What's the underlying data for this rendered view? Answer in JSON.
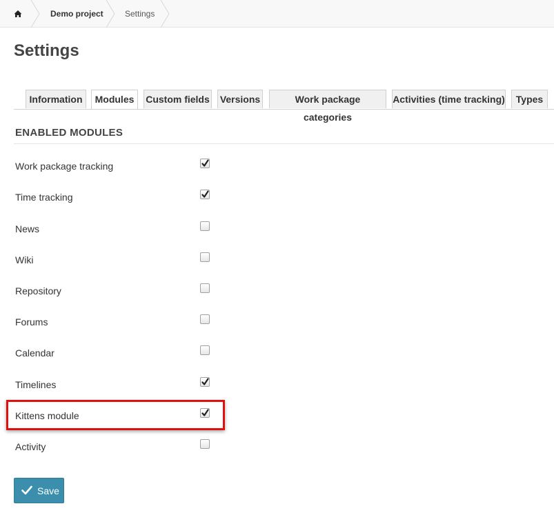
{
  "breadcrumb": {
    "home_icon": "home-icon",
    "items": [
      "Demo project",
      "Settings"
    ]
  },
  "page": {
    "title": "Settings"
  },
  "tabs": [
    {
      "label": "Information",
      "active": false
    },
    {
      "label": "Modules",
      "active": true
    },
    {
      "label": "Custom fields",
      "active": false
    },
    {
      "label": "Versions",
      "active": false
    },
    {
      "label": "Work package categories",
      "active": false
    },
    {
      "label": "Activities (time tracking)",
      "active": false
    },
    {
      "label": "Types",
      "active": false
    }
  ],
  "section": {
    "title": "ENABLED MODULES"
  },
  "modules": [
    {
      "label": "Work package tracking",
      "checked": true
    },
    {
      "label": "Time tracking",
      "checked": true
    },
    {
      "label": "News",
      "checked": false
    },
    {
      "label": "Wiki",
      "checked": false
    },
    {
      "label": "Repository",
      "checked": false
    },
    {
      "label": "Forums",
      "checked": false
    },
    {
      "label": "Calendar",
      "checked": false
    },
    {
      "label": "Timelines",
      "checked": true
    },
    {
      "label": "Kittens module",
      "checked": true,
      "highlighted": true
    },
    {
      "label": "Activity",
      "checked": false
    }
  ],
  "save_button": {
    "label": "Save",
    "icon": "checkmark-icon"
  },
  "colors": {
    "accent": "#3b8fad",
    "highlight": "#e01010"
  }
}
